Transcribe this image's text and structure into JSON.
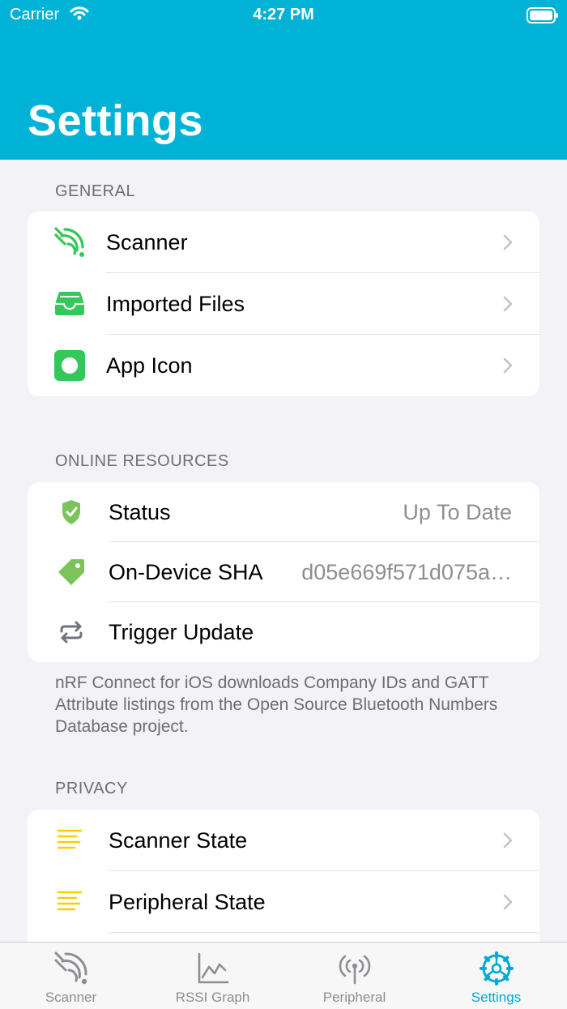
{
  "status_bar": {
    "carrier": "Carrier",
    "time": "4:27 PM"
  },
  "header": {
    "title": "Settings"
  },
  "sections": {
    "general": {
      "header": "GENERAL",
      "items": [
        {
          "label": "Scanner",
          "icon": "scanner-waves-icon"
        },
        {
          "label": "Imported Files",
          "icon": "tray-icon"
        },
        {
          "label": "App Icon",
          "icon": "app-icon-icon"
        }
      ]
    },
    "online": {
      "header": "ONLINE RESOURCES",
      "items": [
        {
          "label": "Status",
          "value": "Up To Date",
          "icon": "shield-check-icon"
        },
        {
          "label": "On-Device SHA",
          "value": "d05e669f571d075a…",
          "icon": "tag-icon"
        },
        {
          "label": "Trigger Update",
          "icon": "refresh-arrows-icon"
        }
      ],
      "footer": "nRF Connect for iOS downloads Company IDs and GATT Attribute listings from the Open Source Bluetooth Numbers Database project."
    },
    "privacy": {
      "header": "PRIVACY",
      "items": [
        {
          "label": "Scanner State",
          "icon": "text-lines-icon"
        },
        {
          "label": "Peripheral State",
          "icon": "text-lines-icon"
        }
      ]
    }
  },
  "tab_bar": {
    "tabs": [
      {
        "label": "Scanner",
        "icon": "scanner-waves-icon"
      },
      {
        "label": "RSSI Graph",
        "icon": "line-chart-icon"
      },
      {
        "label": "Peripheral",
        "icon": "antenna-icon"
      },
      {
        "label": "Settings",
        "icon": "gear-icon",
        "active": true
      }
    ]
  },
  "colors": {
    "accent": "#00b3d6",
    "green": "#34c759",
    "light_green": "#7cc35a",
    "yellow": "#ffcc00",
    "tab_active": "#00a9d6"
  }
}
